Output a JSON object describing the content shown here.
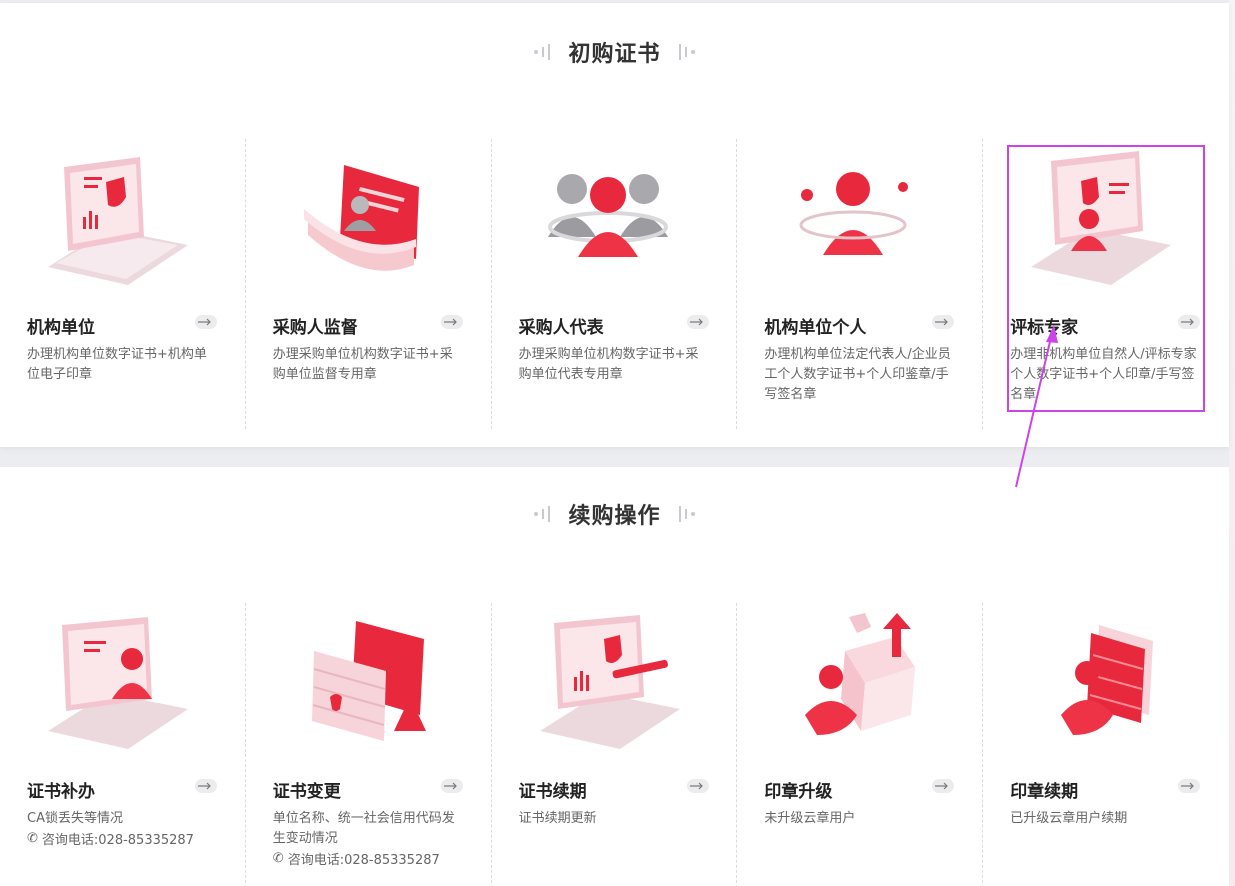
{
  "sections": [
    {
      "title": "初购证书",
      "cards": [
        {
          "title": "机构单位",
          "desc": "办理机构单位数字证书+机构单位电子印章",
          "icon": "laptop-shield-illustration"
        },
        {
          "title": "采购人监督",
          "desc": "办理采购单位机构数字证书+采购单位监督专用章",
          "icon": "supervisor-document-illustration"
        },
        {
          "title": "采购人代表",
          "desc": "办理采购单位机构数字证书+采购单位代表专用章",
          "icon": "group-people-illustration"
        },
        {
          "title": "机构单位个人",
          "desc": "办理机构单位法定代表人/企业员工个人数字证书+个人印鉴章/手写签名章",
          "icon": "person-orbit-illustration"
        },
        {
          "title": "评标专家",
          "desc": "办理非机构单位自然人/评标专家个人数字证书+个人印章/手写签名章",
          "icon": "expert-laptop-illustration"
        }
      ]
    },
    {
      "title": "续购操作",
      "cards": [
        {
          "title": "证书补办",
          "desc": "CA锁丢失等情况",
          "phone": "咨询电话:028-85335287",
          "icon": "laptop-user-illustration"
        },
        {
          "title": "证书变更",
          "desc": "单位名称、统一社会信用代码发生变动情况",
          "phone": "咨询电话:028-85335287",
          "icon": "firewall-warning-illustration"
        },
        {
          "title": "证书续期",
          "desc": "证书续期更新",
          "icon": "laptop-renew-illustration"
        },
        {
          "title": "印章升级",
          "desc": "未升级云章用户",
          "icon": "seal-upgrade-illustration"
        },
        {
          "title": "印章续期",
          "desc": "已升级云章用户续期",
          "icon": "seal-renew-illustration"
        }
      ]
    }
  ],
  "colors": {
    "accent": "#e8283c",
    "highlight": "#cc44e8",
    "title": "#333333",
    "desc": "#666666"
  }
}
